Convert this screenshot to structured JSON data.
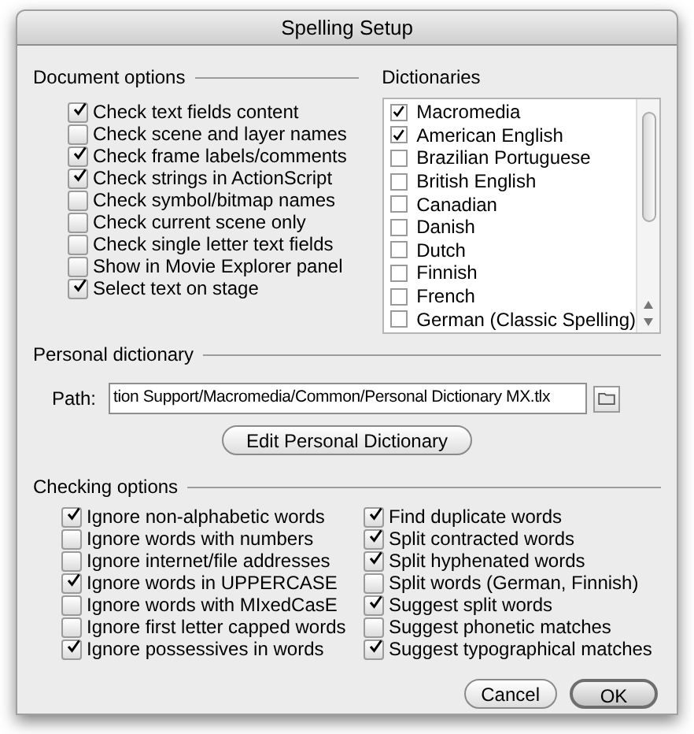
{
  "window": {
    "title": "Spelling Setup"
  },
  "document_options": {
    "title": "Document options",
    "items": [
      {
        "label": "Check text fields content",
        "checked": true
      },
      {
        "label": "Check scene and layer names",
        "checked": false
      },
      {
        "label": "Check frame labels/comments",
        "checked": true
      },
      {
        "label": "Check strings in ActionScript",
        "checked": true
      },
      {
        "label": "Check symbol/bitmap names",
        "checked": false
      },
      {
        "label": "Check current scene only",
        "checked": false
      },
      {
        "label": "Check single letter text fields",
        "checked": false
      },
      {
        "label": "Show in Movie Explorer panel",
        "checked": false
      },
      {
        "label": "Select text on stage",
        "checked": true
      }
    ]
  },
  "dictionaries": {
    "title": "Dictionaries",
    "items": [
      {
        "label": "Macromedia",
        "checked": true
      },
      {
        "label": "American English",
        "checked": true
      },
      {
        "label": "Brazilian Portuguese",
        "checked": false
      },
      {
        "label": "British English",
        "checked": false
      },
      {
        "label": "Canadian",
        "checked": false
      },
      {
        "label": "Danish",
        "checked": false
      },
      {
        "label": "Dutch",
        "checked": false
      },
      {
        "label": "Finnish",
        "checked": false
      },
      {
        "label": "French",
        "checked": false
      },
      {
        "label": "German (Classic Spelling)",
        "checked": false
      }
    ]
  },
  "personal_dictionary": {
    "title": "Personal dictionary",
    "path_label": "Path:",
    "path_value": "tion Support/Macromedia/Common/Personal Dictionary MX.tlx",
    "edit_button": "Edit Personal Dictionary"
  },
  "checking_options": {
    "title": "Checking options",
    "columns": [
      [
        {
          "label": "Ignore non-alphabetic words",
          "checked": true
        },
        {
          "label": "Ignore words with numbers",
          "checked": false
        },
        {
          "label": "Ignore internet/file addresses",
          "checked": false
        },
        {
          "label": "Ignore words in UPPERCASE",
          "checked": true
        },
        {
          "label": "Ignore words with MIxedCasE",
          "checked": false
        },
        {
          "label": "Ignore first letter capped words",
          "checked": false
        },
        {
          "label": "Ignore possessives in words",
          "checked": true
        }
      ],
      [
        {
          "label": "Find duplicate words",
          "checked": true
        },
        {
          "label": "Split contracted words",
          "checked": true
        },
        {
          "label": "Split hyphenated words",
          "checked": true
        },
        {
          "label": "Split words (German, Finnish)",
          "checked": false
        },
        {
          "label": "Suggest split words",
          "checked": true
        },
        {
          "label": "Suggest phonetic matches",
          "checked": false
        },
        {
          "label": "Suggest typographical matches",
          "checked": true
        }
      ]
    ]
  },
  "buttons": [
    {
      "label": "Cancel",
      "default": false
    },
    {
      "label": "OK",
      "default": true
    }
  ]
}
